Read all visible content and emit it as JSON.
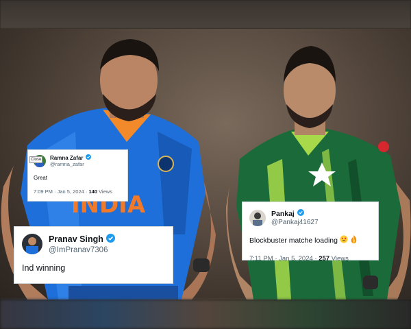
{
  "image_caption_alt": "",
  "close_label": "Close",
  "tweets": [
    {
      "name": "Ramna Zafar",
      "handle": "@ramna_zafar",
      "text": "Great",
      "time": "7:09 PM · Jan 5, 2024 · ",
      "views_count": "140",
      "views_label": " Views"
    },
    {
      "name": "Pranav Singh",
      "handle": "@ImPranav7306",
      "text": "Ind winning"
    },
    {
      "name": "Pankaj",
      "handle": "@Pankaj41627",
      "text": "Blockbuster matche loading",
      "time": "7:11 PM · Jan 5, 2024 · ",
      "views_count": "257",
      "views_label": " Views"
    }
  ],
  "jersey_left_text": "INDIA",
  "colors": {
    "verified": "#1d9bf0",
    "india_blue": "#1e6fd9",
    "pakistan_green": "#1b6b3a"
  }
}
